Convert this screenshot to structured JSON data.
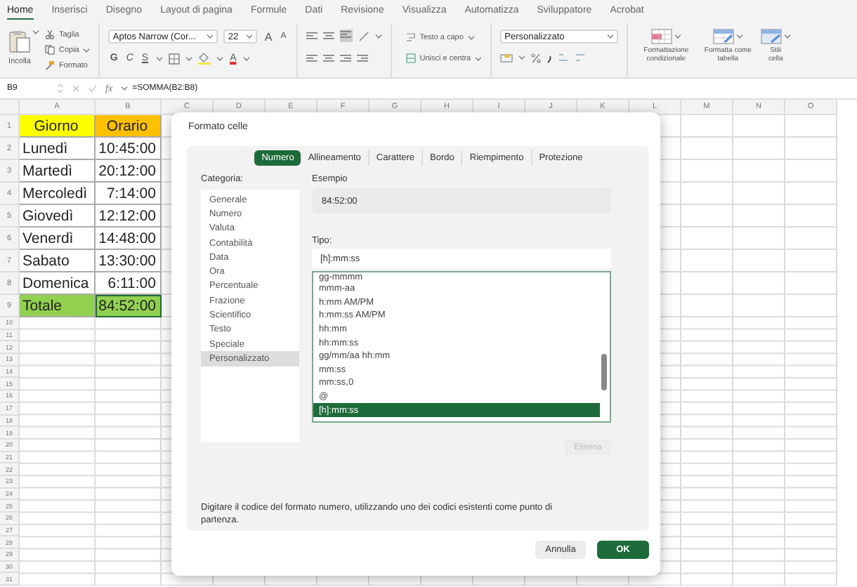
{
  "ribbon_tabs": [
    {
      "label": "Home",
      "selected": true
    },
    {
      "label": "Inserisci",
      "selected": false
    },
    {
      "label": "Disegno",
      "selected": false
    },
    {
      "label": "Layout di pagina",
      "selected": false
    },
    {
      "label": "Formule",
      "selected": false
    },
    {
      "label": "Dati",
      "selected": false
    },
    {
      "label": "Revisione",
      "selected": false
    },
    {
      "label": "Visualizza",
      "selected": false
    },
    {
      "label": "Automatizza",
      "selected": false
    },
    {
      "label": "Sviluppatore",
      "selected": false
    },
    {
      "label": "Acrobat",
      "selected": false
    }
  ],
  "clipboard": {
    "paste": "Incolla",
    "cut": "Taglia",
    "copy": "Copia",
    "format_painter": "Formato"
  },
  "font": {
    "name": "Aptos Narrow (Cor...",
    "size": "22",
    "grow": "A",
    "shrink": "A",
    "bold": "G",
    "italic": "C",
    "underline": "S",
    "color_letter": "A"
  },
  "alignment": {
    "wrap": "Testo a capo",
    "merge": "Unisci e centra"
  },
  "number": {
    "format": "Personalizzato"
  },
  "styles": [
    "Formattazione condizionale",
    "Formatta come tabella",
    "Stili cella"
  ],
  "formula_bar": {
    "cell": "B9",
    "fx": "fx",
    "formula": "=SOMMA(B2:B8)"
  },
  "sheet": {
    "columns": [
      "A",
      "B",
      "C",
      "D",
      "E",
      "F",
      "G",
      "H",
      "I",
      "J",
      "K",
      "L",
      "M",
      "N",
      "O"
    ],
    "rows": [
      {
        "number": "1",
        "kind": "header",
        "cells": [
          {
            "text": "Giorno",
            "selected": false
          },
          {
            "text": "Orario",
            "selected": false
          }
        ]
      },
      {
        "number": "2",
        "kind": "data",
        "cells": [
          {
            "text": "Lunedì",
            "selected": false
          },
          {
            "text": "10:45:00",
            "selected": false
          }
        ]
      },
      {
        "number": "3",
        "kind": "data",
        "cells": [
          {
            "text": "Martedì",
            "selected": false
          },
          {
            "text": "20:12:00",
            "selected": false
          }
        ]
      },
      {
        "number": "4",
        "kind": "data",
        "cells": [
          {
            "text": "Mercoledì",
            "selected": false
          },
          {
            "text": "7:14:00",
            "selected": false
          }
        ]
      },
      {
        "number": "5",
        "kind": "data",
        "cells": [
          {
            "text": "Giovedì",
            "selected": false
          },
          {
            "text": "12:12:00",
            "selected": false
          }
        ]
      },
      {
        "number": "6",
        "kind": "data",
        "cells": [
          {
            "text": "Venerdì",
            "selected": false
          },
          {
            "text": "14:48:00",
            "selected": false
          }
        ]
      },
      {
        "number": "7",
        "kind": "data",
        "cells": [
          {
            "text": "Sabato",
            "selected": false
          },
          {
            "text": "13:30:00",
            "selected": false
          }
        ]
      },
      {
        "number": "8",
        "kind": "data",
        "cells": [
          {
            "text": "Domenica",
            "selected": false
          },
          {
            "text": "6:11:00",
            "selected": false
          }
        ]
      },
      {
        "number": "9",
        "kind": "total",
        "cells": [
          {
            "text": "Totale",
            "selected": false
          },
          {
            "text": "84:52:00",
            "selected": true
          }
        ]
      }
    ],
    "empty_rows": [
      "10",
      "11",
      "12",
      "13",
      "14",
      "15",
      "16",
      "17",
      "18",
      "19",
      "20",
      "21",
      "22",
      "23",
      "24",
      "25",
      "26",
      "27",
      "28",
      "29",
      "30",
      "31"
    ]
  },
  "dialog": {
    "title": "Formato celle",
    "tabs": [
      {
        "label": "Numero",
        "selected": true
      },
      {
        "label": "Allineamento",
        "selected": false
      },
      {
        "label": "Carattere",
        "selected": false
      },
      {
        "label": "Bordo",
        "selected": false
      },
      {
        "label": "Riempimento",
        "selected": false
      },
      {
        "label": "Protezione",
        "selected": false
      }
    ],
    "category_label": "Categoria:",
    "categories": [
      {
        "label": "Generale",
        "selected": false
      },
      {
        "label": "Numero",
        "selected": false
      },
      {
        "label": "Valuta",
        "selected": false
      },
      {
        "label": "Contabilità",
        "selected": false
      },
      {
        "label": "Data",
        "selected": false
      },
      {
        "label": "Ora",
        "selected": false
      },
      {
        "label": "Percentuale",
        "selected": false
      },
      {
        "label": "Frazione",
        "selected": false
      },
      {
        "label": "Scientifico",
        "selected": false
      },
      {
        "label": "Testo",
        "selected": false
      },
      {
        "label": "Speciale",
        "selected": false
      },
      {
        "label": "Personalizzato",
        "selected": true
      }
    ],
    "sample_label": "Esempio",
    "sample": "84:52:00",
    "type_label": "Tipo:",
    "type_value": "[h]:mm:ss",
    "formats": [
      {
        "label": "gg-mmmm",
        "selected": false
      },
      {
        "label": "mmm-aa",
        "selected": false
      },
      {
        "label": "h:mm AM/PM",
        "selected": false
      },
      {
        "label": "h:mm:ss AM/PM",
        "selected": false
      },
      {
        "label": "hh:mm",
        "selected": false
      },
      {
        "label": "hh:mm:ss",
        "selected": false
      },
      {
        "label": "gg/mm/aa hh:mm",
        "selected": false
      },
      {
        "label": "mm:ss",
        "selected": false
      },
      {
        "label": "mm:ss,0",
        "selected": false
      },
      {
        "label": "@",
        "selected": false
      },
      {
        "label": "[h]:mm:ss",
        "selected": true
      }
    ],
    "delete_button": {
      "label": "Elimina",
      "disabled": true
    },
    "description": "Digitare il codice del formato numero, utilizzando uno dei codici esistenti come punto di partenza.",
    "cancel": "Annulla",
    "ok": "OK"
  }
}
